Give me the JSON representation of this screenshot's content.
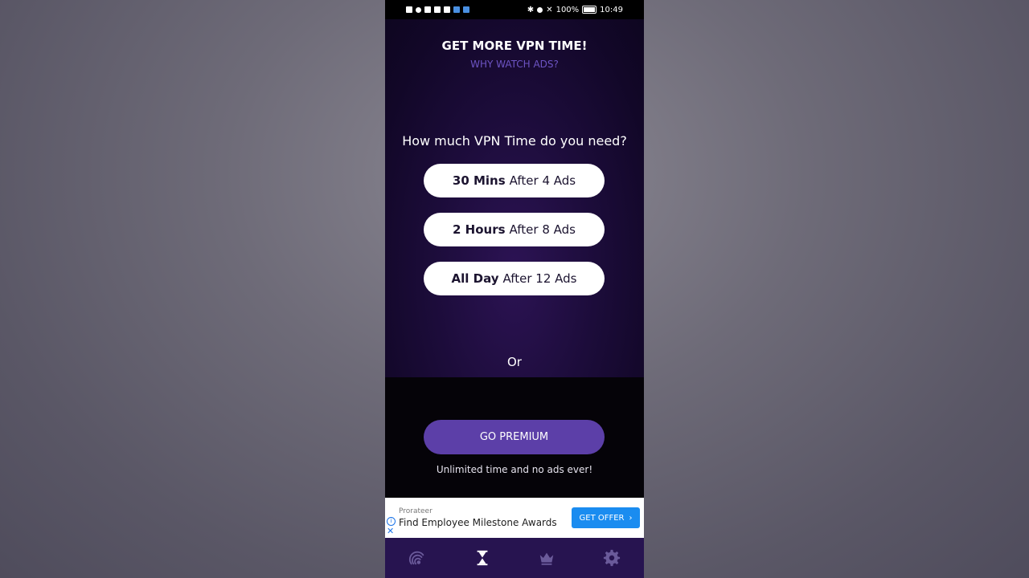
{
  "status_bar": {
    "battery": "100%",
    "time": "10:49"
  },
  "header": {
    "title": "GET MORE VPN TIME!",
    "subtitle": "WHY WATCH ADS?"
  },
  "question": "How much VPN Time do you need?",
  "options": [
    {
      "bold": "30 Mins",
      "rest": "After 4 Ads"
    },
    {
      "bold": "2 Hours",
      "rest": "After 8 Ads"
    },
    {
      "bold": "All Day",
      "rest": "After 12 Ads"
    }
  ],
  "or_text": "Or",
  "premium": {
    "label": "GO PREMIUM",
    "note": "Unlimited time and no ads ever!"
  },
  "ad": {
    "sponsor": "Prorateer",
    "text": "Find Employee Milestone Awards",
    "cta": "GET OFFER"
  },
  "nav": {
    "active": "timer",
    "icons": [
      "vpn-icon",
      "hourglass-icon",
      "crown-icon",
      "gear-icon"
    ]
  },
  "colors": {
    "accent": "#5c3fa8",
    "nav_bg": "#271450",
    "link": "#6d54c4",
    "ad_cta": "#1a8cf0"
  }
}
